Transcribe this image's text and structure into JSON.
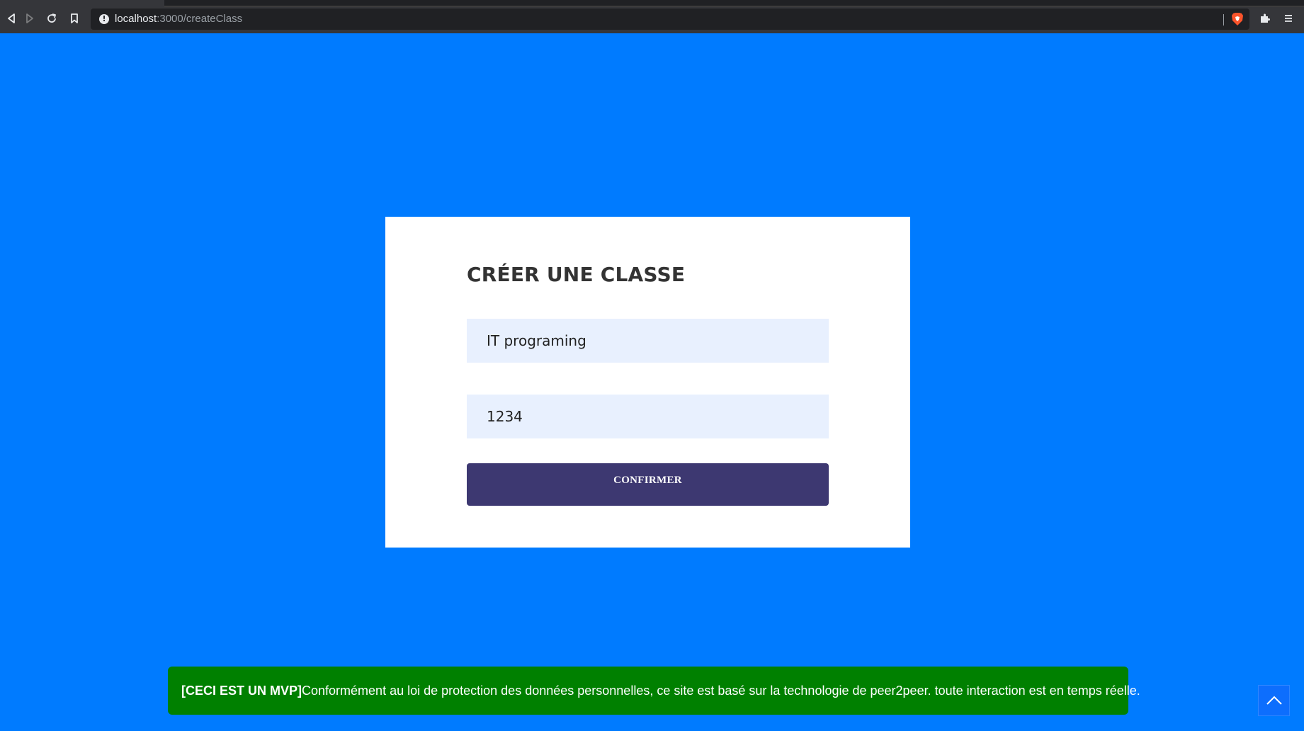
{
  "browser": {
    "url_host": "localhost",
    "url_path": ":3000/createClass",
    "icons": {
      "back": "back-arrow-icon",
      "forward": "forward-arrow-icon",
      "reload": "reload-icon",
      "bookmark": "bookmark-icon",
      "site_info": "info-icon",
      "brave_shield": "brave-shield-icon",
      "extensions": "puzzle-icon",
      "menu": "hamburger-menu-icon"
    }
  },
  "page": {
    "background_color": "#007bff"
  },
  "form": {
    "title": "CRÉER UNE CLASSE",
    "class_name_value": "IT programing",
    "class_code_value": "1234",
    "confirm_label": "CONFIRMER",
    "button_color": "#3d3871",
    "field_color": "#e8f0fe"
  },
  "banner": {
    "bold_text": "[CECI EST UN MVP]",
    "text": "Conformément au loi de protection des données personnelles, ce site est basé sur la technologie de peer2peer. toute interaction est en temps réelle.",
    "color": "#008000"
  },
  "scroll_top": {
    "icon": "chevron-up-icon"
  }
}
